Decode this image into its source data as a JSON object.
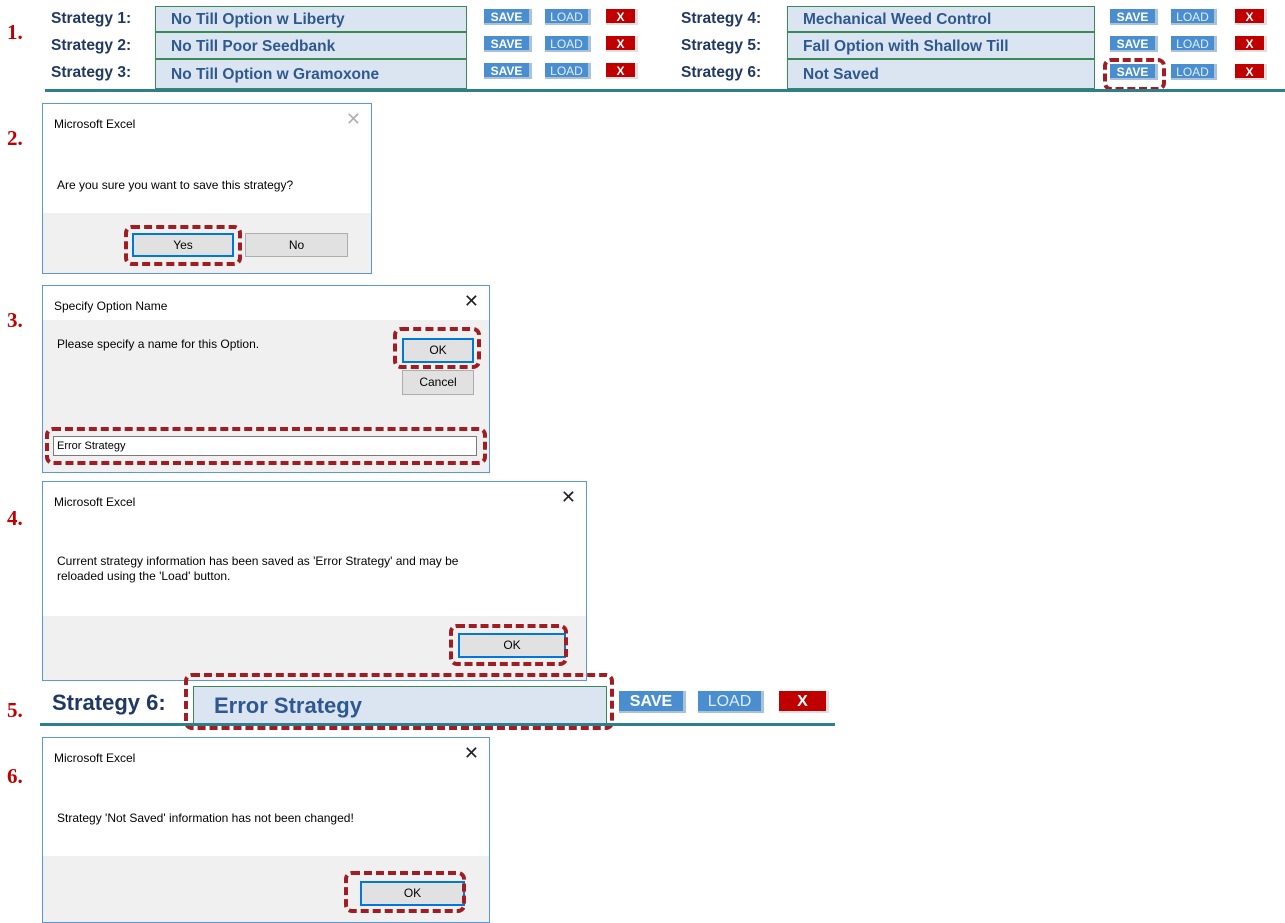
{
  "steps": [
    "1.",
    "2.",
    "3.",
    "4.",
    "5.",
    "6."
  ],
  "strategies": [
    {
      "label": "Strategy 1:",
      "name": "No Till Option w Liberty"
    },
    {
      "label": "Strategy 2:",
      "name": "No Till Poor Seedbank"
    },
    {
      "label": "Strategy 3:",
      "name": "No Till Option w Gramoxone"
    },
    {
      "label": "Strategy 4:",
      "name": "Mechanical Weed Control"
    },
    {
      "label": "Strategy 5:",
      "name": "Fall Option with Shallow Till"
    },
    {
      "label": "Strategy 6:",
      "name": "Not Saved"
    }
  ],
  "buttons": {
    "save": "SAVE",
    "load": "LOAD",
    "delete": "X"
  },
  "dialog_confirm": {
    "title": "Microsoft Excel",
    "message": "Are you sure you want to save this strategy?",
    "yes": "Yes",
    "no": "No"
  },
  "dialog_name": {
    "title": "Specify Option Name",
    "message": "Please specify a name for this Option.",
    "ok": "OK",
    "cancel": "Cancel",
    "input_value": "Error Strategy"
  },
  "dialog_saved": {
    "title": "Microsoft Excel",
    "message_line1": "Current strategy information has been saved as 'Error Strategy' and may be",
    "message_line2": "reloaded using the 'Load' button.",
    "ok": "OK"
  },
  "result_row": {
    "label": "Strategy 6:",
    "name": "Error Strategy"
  },
  "dialog_unchanged": {
    "title": "Microsoft Excel",
    "message": "Strategy 'Not Saved' information has not been changed!",
    "ok": "OK"
  },
  "colors": {
    "highlight": "#a11d24",
    "step_number": "#c00000",
    "label": "#1f3864",
    "name_box": "#dbe5f1",
    "save_button": "#4a8ed0",
    "delete_button": "#c00000",
    "rule": "#2f7f8a"
  },
  "icons": {
    "close": "close-icon"
  }
}
